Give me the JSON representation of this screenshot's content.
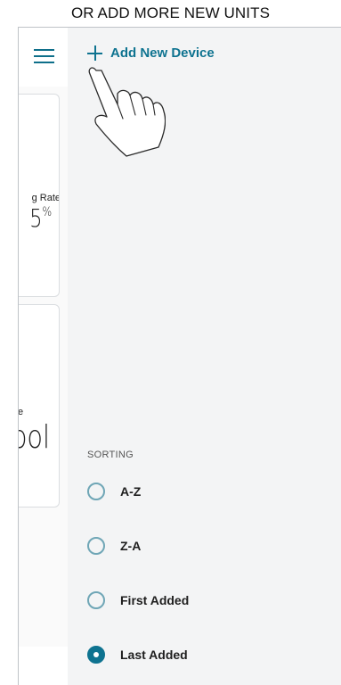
{
  "banner": {
    "text": "OR ADD MORE NEW UNITS"
  },
  "background_screen": {
    "menu_icon": "hamburger-menu-icon",
    "card1": {
      "label": "g Rate",
      "value": "5",
      "unit": "%"
    },
    "card2": {
      "label": "e",
      "value": "ool"
    }
  },
  "drawer": {
    "add_device": {
      "label": "Add New Device",
      "icon": "plus-icon"
    },
    "hint_icon": "pointing-hand-icon",
    "sorting": {
      "title": "SORTING",
      "options": [
        {
          "label": "A-Z",
          "checked": false
        },
        {
          "label": "Z-A",
          "checked": false
        },
        {
          "label": "First Added",
          "checked": false
        },
        {
          "label": "Last Added",
          "checked": true
        }
      ]
    }
  },
  "colors": {
    "accent": "#0e7390",
    "radio_border": "#6fa6b6",
    "drawer_bg": "#f3f4f5"
  }
}
